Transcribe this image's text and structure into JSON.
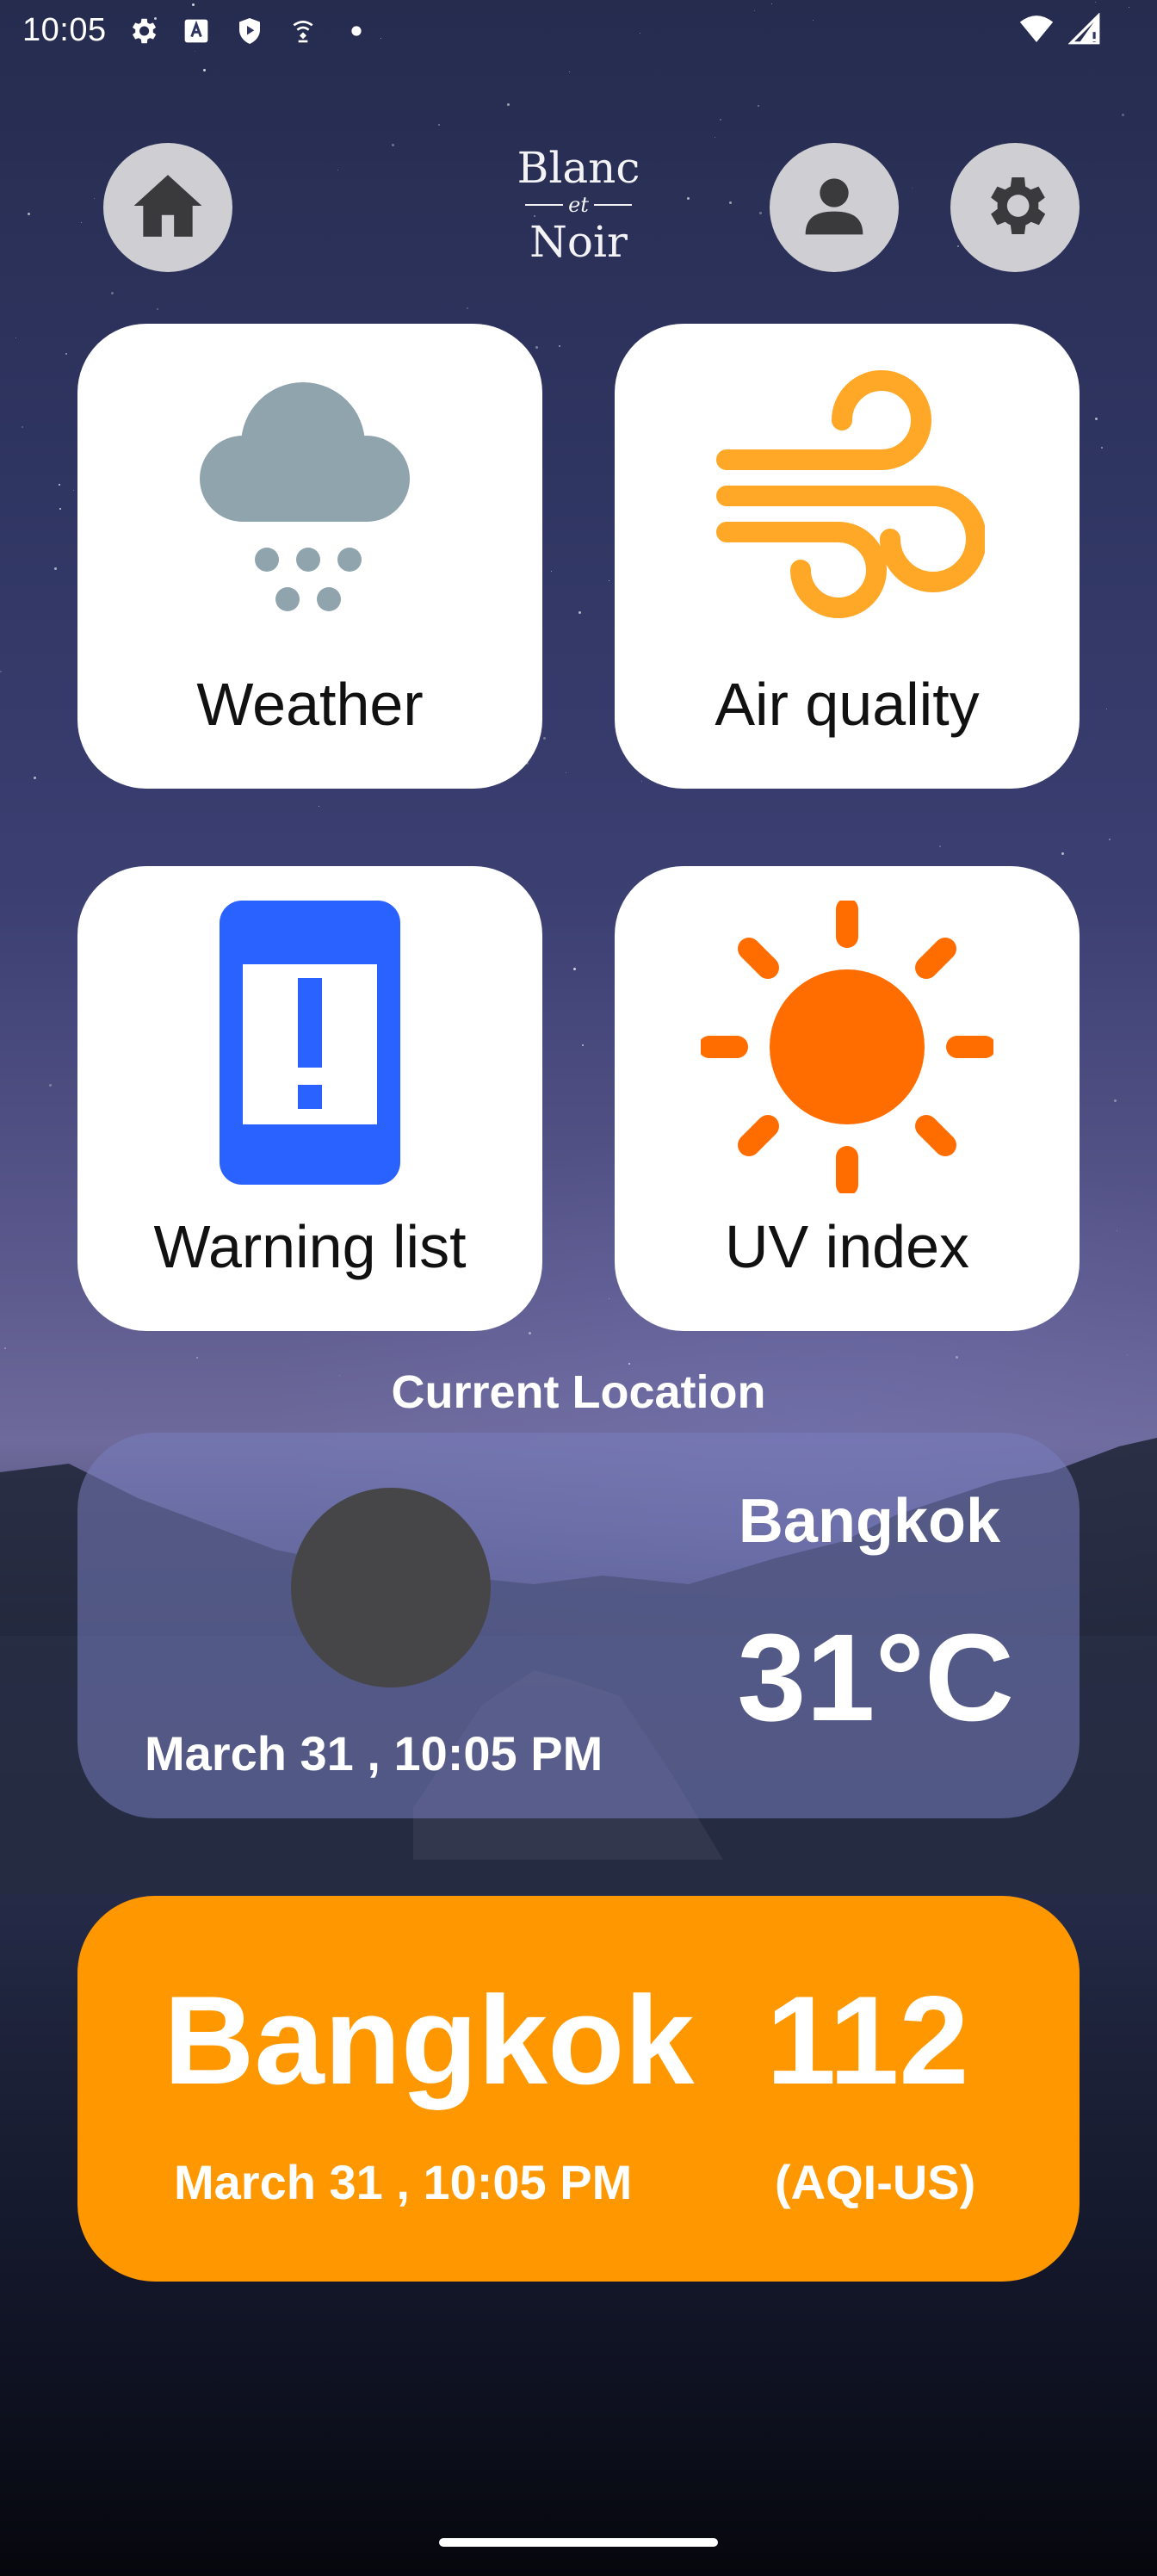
{
  "status_bar": {
    "time": "10:05",
    "left_icons": [
      "settings-icon",
      "font-icon",
      "shield-play-icon",
      "wifi-sync-icon",
      "dot-icon"
    ],
    "right_icons": [
      "wifi-icon",
      "cellular-signal-icon"
    ]
  },
  "header": {
    "logo": {
      "line1": "Blanc",
      "line2": "et",
      "line3": "Noir"
    },
    "buttons": [
      "home-icon",
      "profile-icon",
      "settings-icon"
    ]
  },
  "tiles": [
    {
      "label": "Weather",
      "icon": "rain-cloud-icon"
    },
    {
      "label": "Air quality",
      "icon": "wind-icon"
    },
    {
      "label": "Warning list",
      "icon": "phone-alert-icon"
    },
    {
      "label": "UV index",
      "icon": "sun-icon"
    }
  ],
  "current_location": {
    "title": "Current Location",
    "city": "Bangkok",
    "temperature": "31°C",
    "datetime": "March 31 , 10:05 PM"
  },
  "air_quality_card": {
    "city": "Bangkok",
    "aqi": "112",
    "datetime": "March 31 , 10:05 PM",
    "unit": "(AQI-US)"
  },
  "colors": {
    "tile_bg": "#ffffff",
    "button_bg": "#cfcfd3",
    "button_icon": "#3a3a3c",
    "cloud": "#90a4ae",
    "wind": "#ffa726",
    "warning_phone": "#2962ff",
    "sun": "#ff6d00",
    "aqi_card": "#ff9800",
    "location_card": "#787ebe"
  }
}
